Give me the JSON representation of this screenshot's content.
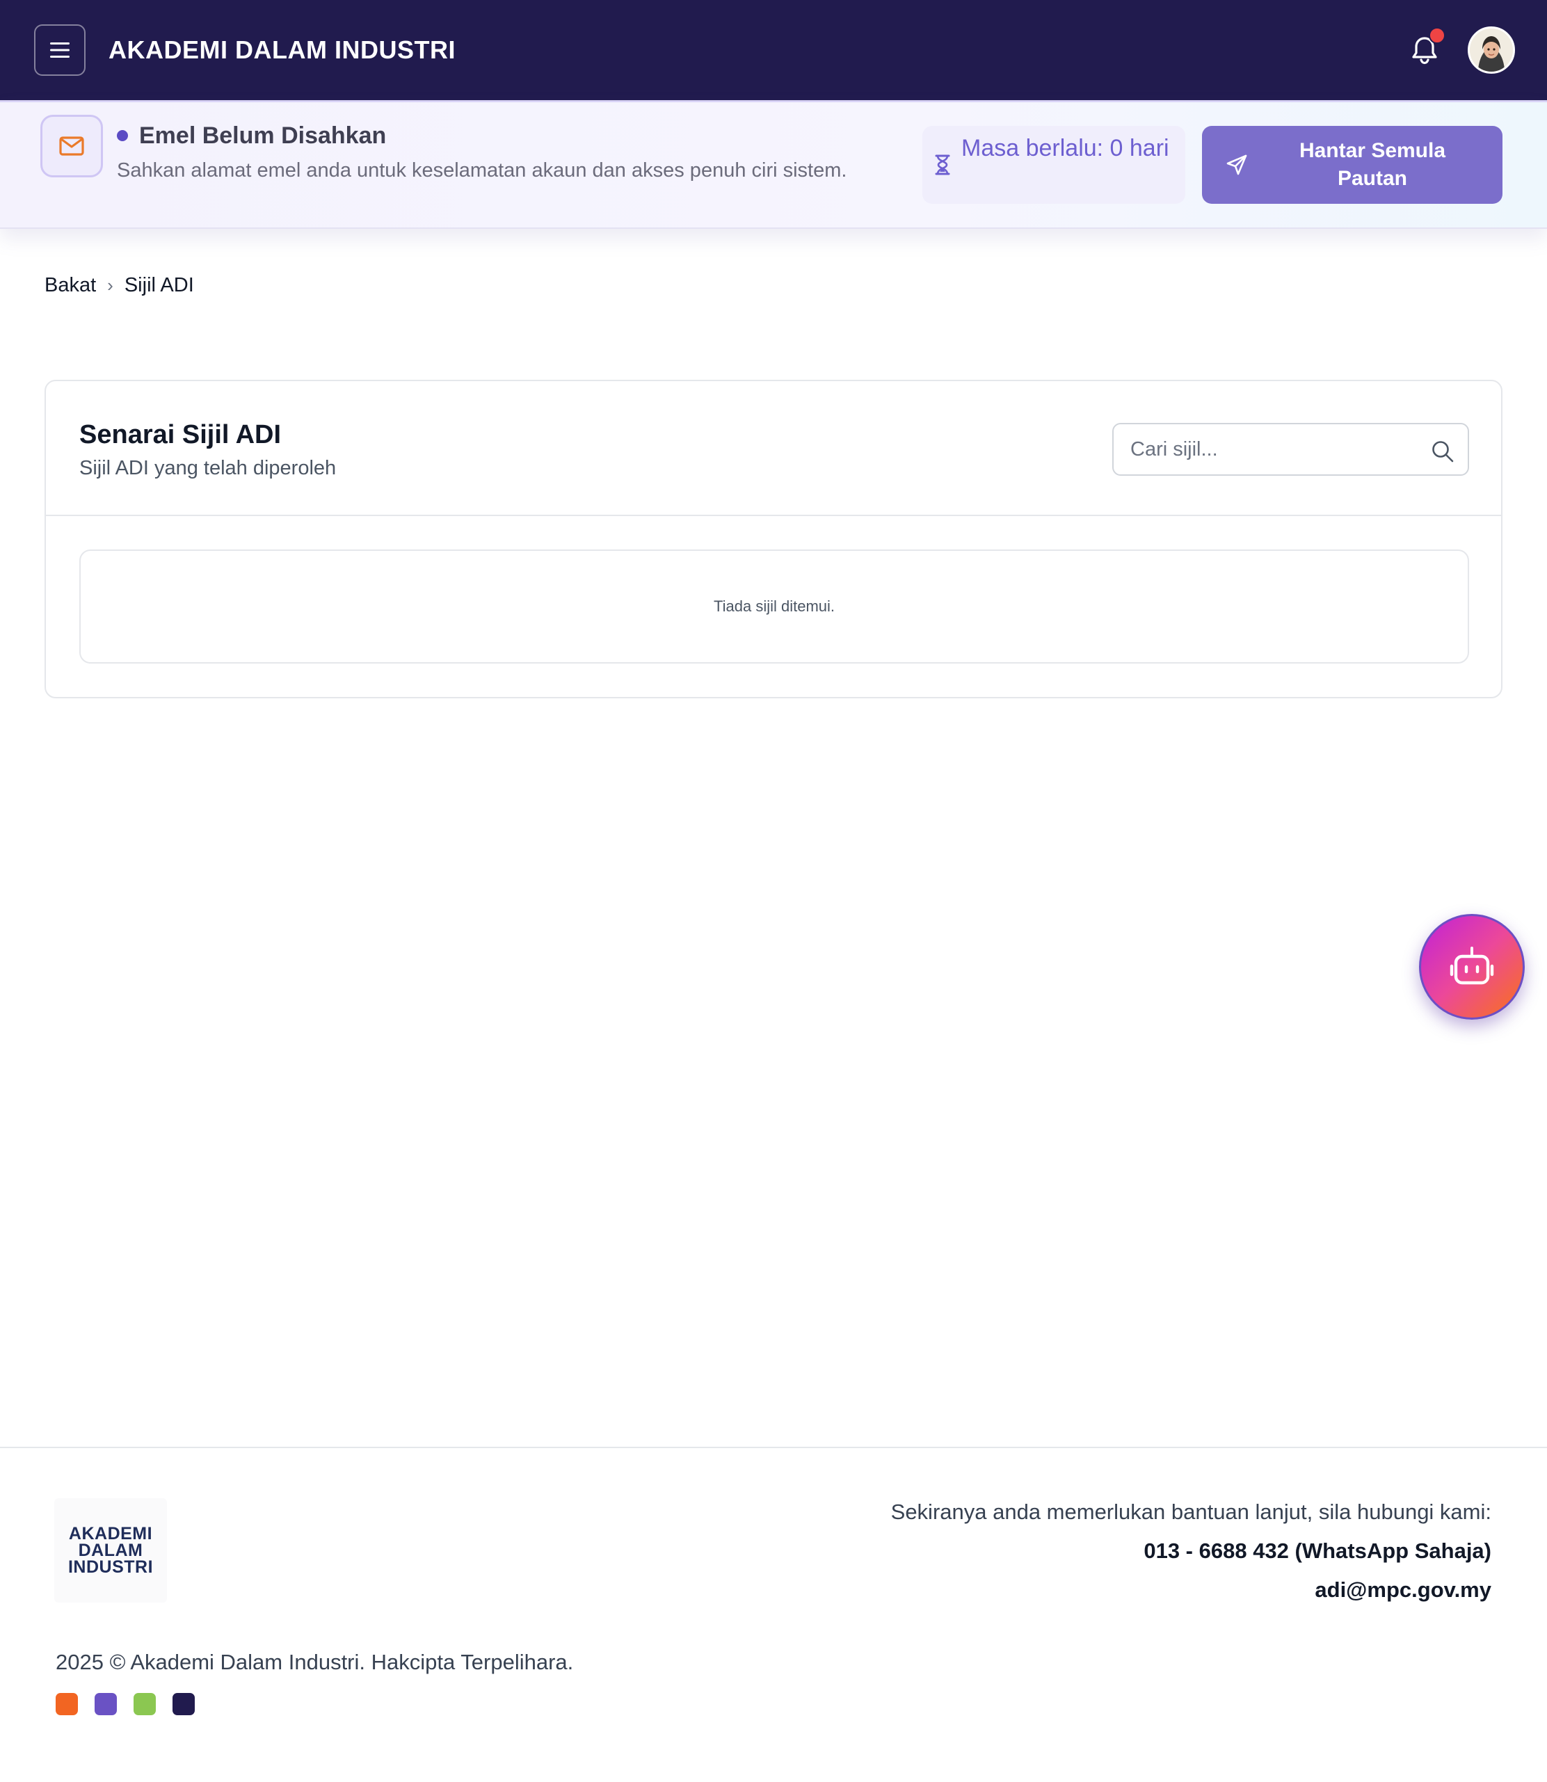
{
  "header": {
    "app_title": "AKADEMI DALAM INDUSTRI",
    "menu_icon": "hamburger-menu-icon",
    "notification_icon": "bell-icon",
    "has_unread_notification": true,
    "colors": {
      "background": "#211b4e",
      "notification_dot": "#ef4444"
    }
  },
  "banner": {
    "icon": "envelope-icon",
    "title": "Emel Belum Disahkan",
    "description": "Sahkan alamat emel anda untuk keselamatan akaun dan akses penuh ciri sistem.",
    "elapsed_icon": "hourglass-icon",
    "elapsed_text": "Masa berlalu: 0 hari",
    "resend_icon": "send-icon",
    "resend_label": "Hantar Semula Pautan",
    "colors": {
      "accent": "#7b6ecb",
      "icon": "#ea7a2a"
    }
  },
  "breadcrumb": {
    "items": [
      "Bakat",
      "Sijil ADI"
    ],
    "separator": "›"
  },
  "card": {
    "title": "Senarai Sijil ADI",
    "subtitle": "Sijil ADI yang telah diperoleh",
    "search": {
      "value": "",
      "placeholder": "Cari sijil..."
    },
    "empty_message": "Tiada sijil ditemui."
  },
  "chatbot": {
    "icon": "robot-icon"
  },
  "footer": {
    "logo_lines": [
      "AKADEMI",
      "DALAM",
      "INDUSTRI"
    ],
    "contact_lead": "Sekiranya anda memerlukan bantuan lanjut, sila hubungi kami:",
    "phone": "013 - 6688 432 (WhatsApp Sahaja)",
    "email": "adi@mpc.gov.my",
    "copyright": "2025 © Akademi Dalam Industri. Hakcipta Terpelihara.",
    "brand_colors": [
      "#f26522",
      "#6a52c4",
      "#8bc751",
      "#211b4e"
    ]
  }
}
